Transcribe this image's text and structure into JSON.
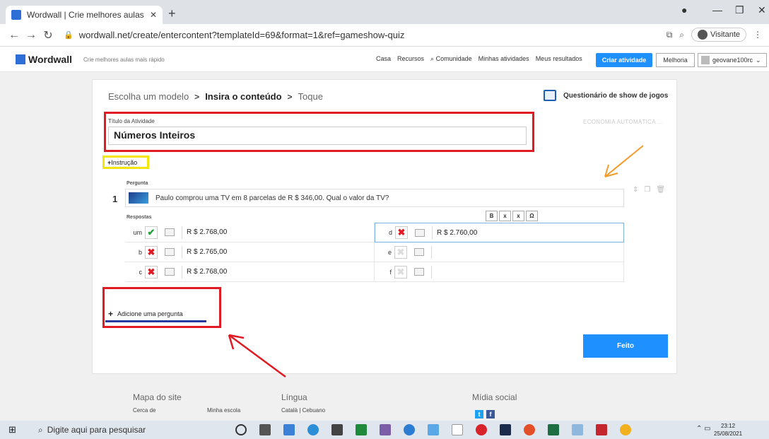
{
  "browser": {
    "tab_title": "Wordwall | Crie melhores aulas m",
    "url": "wordwall.net/create/entercontent?templateId=69&format=1&ref=gameshow-quiz",
    "profile_label": "Visitante"
  },
  "header": {
    "logo": "Wordwall",
    "tagline": "Crie melhores aulas mais rápido",
    "nav": [
      "Casa",
      "Recursos",
      "Comunidade",
      "Minhas atividades",
      "Meus resultados"
    ],
    "create_button": "Criar atividade",
    "upgrade_button": "Melhoria",
    "user_name": "geovane100rc"
  },
  "wizard": {
    "step1": "Escolha um modelo",
    "step2": "Insira o conteúdo",
    "step3": "Toque",
    "template_name": "Questionário de show de jogos",
    "autosave": "ECONOMIA AUTOMÁTICA ..."
  },
  "form": {
    "title_label": "Título da Atividade",
    "title_value": "Números Inteiros",
    "instruction_link": "Instrução",
    "question_label": "Pergunta",
    "question_number": "1",
    "question_text": "Paulo comprou uma TV em 8 parcelas de R $ 346,00. Qual o valor da TV?",
    "answers_label": "Respostas",
    "answers": [
      {
        "letter": "um",
        "status": "correct",
        "value": "R $ 2.768,00"
      },
      {
        "letter": "b",
        "status": "wrong",
        "value": "R $ 2.765,00"
      },
      {
        "letter": "c",
        "status": "wrong",
        "value": "R $ 2.768,00"
      },
      {
        "letter": "d",
        "status": "wrong",
        "value": "R $ 2.760,00"
      },
      {
        "letter": "e",
        "status": "empty",
        "value": ""
      },
      {
        "letter": "f",
        "status": "empty",
        "value": ""
      }
    ],
    "format_buttons": [
      "B",
      "x",
      "x",
      "Ω"
    ],
    "add_question": "Adicione uma pergunta",
    "done_button": "Feito"
  },
  "footer": {
    "sitemap_title": "Mapa do site",
    "sitemap_item1": "Cerca de",
    "sitemap_item2": "Minha escola",
    "language_title": "Língua",
    "languages": "Català | Cebuano",
    "social_title": "Mídia social"
  },
  "taskbar": {
    "search_placeholder": "Digite aqui para pesquisar",
    "time": "23:12",
    "date": "25/08/2021"
  },
  "colors": {
    "accent": "#1e90ff",
    "annotation_red": "#e01b24",
    "annotation_yellow": "#f2e60c",
    "annotation_orange": "#f39a2b",
    "annotation_blue": "#2b3a9e"
  }
}
